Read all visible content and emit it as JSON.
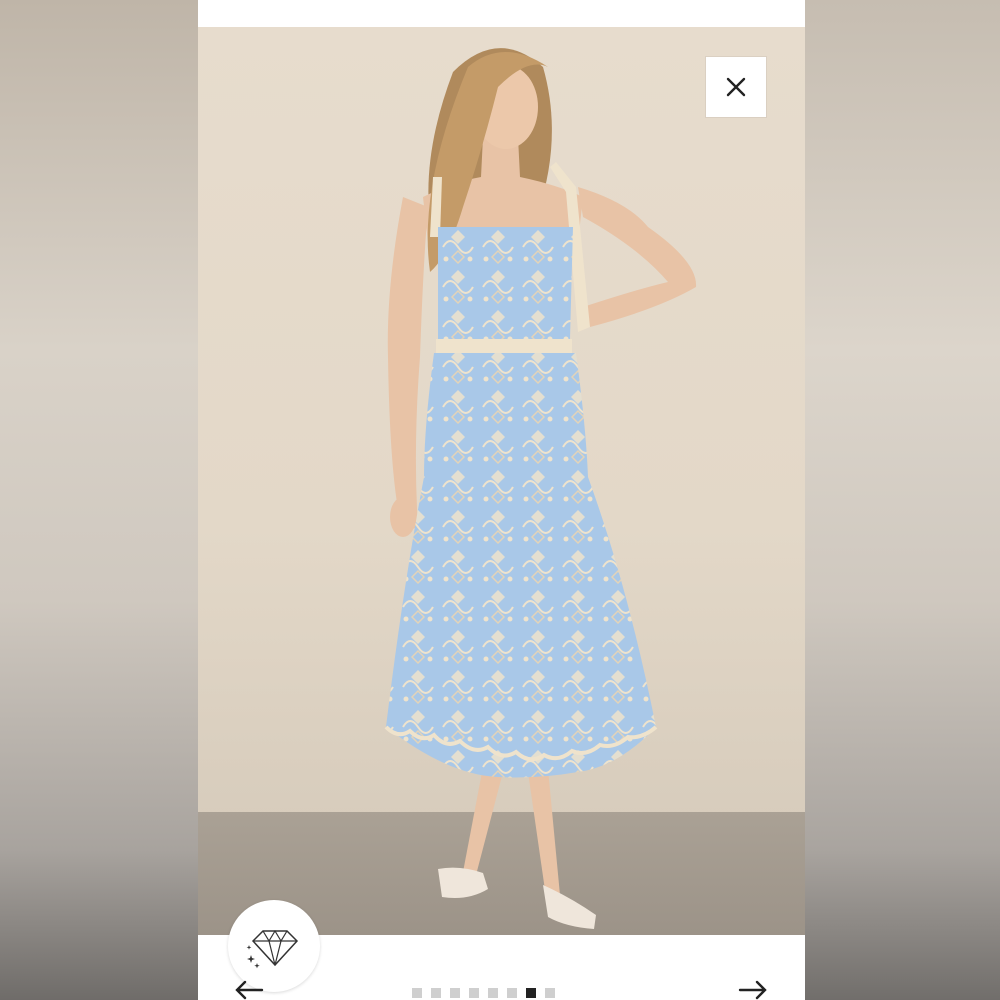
{
  "page": {
    "background": "#cfc8bf"
  },
  "modal": {
    "background": "#ffffff",
    "close_icon": "close-icon",
    "badge_icon": "diamond-sparkle-icon"
  },
  "product_image": {
    "alt": "",
    "dress_color": "#a9c8e8",
    "lace_color": "#efe3cc",
    "wall_color": "#e6dbcb",
    "floor_color": "#a39a8f"
  },
  "carousel": {
    "prev_icon": "arrow-left-icon",
    "next_icon": "arrow-right-icon",
    "total_slides": 8,
    "active_slide": 7
  }
}
